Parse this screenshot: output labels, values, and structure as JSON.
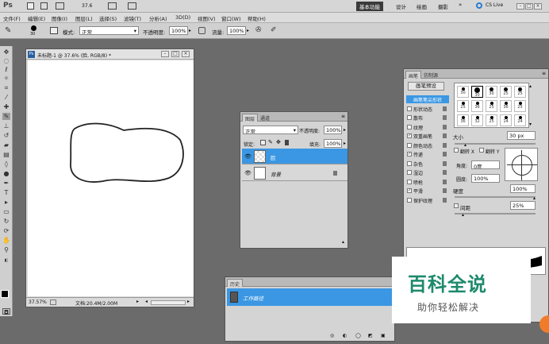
{
  "app": {
    "logo": "Ps",
    "workspace_label": "基本功能",
    "workspaces": [
      "设计",
      "绘画",
      "摄影"
    ],
    "more": "»",
    "cslive": "CS Live",
    "zoom": "37.6",
    "colors": {
      "blue": "#3b97e3",
      "live_icon": "#2a7bd1"
    }
  },
  "menu": [
    "文件(F)",
    "编辑(E)",
    "图像(I)",
    "图层(L)",
    "选择(S)",
    "滤镜(T)",
    "分析(A)",
    "3D(D)",
    "视图(V)",
    "窗口(W)",
    "帮助(H)"
  ],
  "options": {
    "brush_size": "30",
    "mode_label": "模式:",
    "mode_value": "正常",
    "opacity_label": "不透明度:",
    "opacity_value": "100%",
    "flow_label": "流量:",
    "flow_value": "100%"
  },
  "document": {
    "title": "未标题-1 @ 37.6% (脸, RGB/8) *",
    "zoom": "37.57%",
    "doc_info": "文档:20.4M/2.00M"
  },
  "layers": {
    "tabs": [
      "图层",
      "通道"
    ],
    "blend": "正常",
    "opacity_label": "不透明度:",
    "opacity": "100%",
    "lock_label": "锁定:",
    "fill_label": "填充:",
    "fill": "100%",
    "items": [
      {
        "name": "脸"
      },
      {
        "name": "背景"
      }
    ]
  },
  "history": {
    "tab": "历史",
    "items": [
      {
        "name": "工作路径"
      }
    ]
  },
  "brush_panel": {
    "tabs": [
      "画笔",
      "仿制源"
    ],
    "presets_button": "画笔预设",
    "categories": [
      {
        "label": "画笔笔尖形状",
        "checked": false
      },
      {
        "label": "形状动态",
        "checked": false
      },
      {
        "label": "散布",
        "checked": false
      },
      {
        "label": "纹理",
        "checked": false
      },
      {
        "label": "双重画笔",
        "checked": true
      },
      {
        "label": "颜色动态",
        "checked": false
      },
      {
        "label": "传递",
        "checked": true
      },
      {
        "label": "杂色",
        "checked": false
      },
      {
        "label": "湿边",
        "checked": false
      },
      {
        "label": "喷枪",
        "checked": false
      },
      {
        "label": "平滑",
        "checked": true
      },
      {
        "label": "保护纹理",
        "checked": false
      }
    ],
    "tip_sizes": [
      "30",
      "30",
      "30",
      "25",
      "25",
      "25",
      "36",
      "25",
      "36",
      "25",
      "36",
      "32",
      "25",
      "14",
      "24"
    ],
    "size_label": "大小",
    "size": "30 px",
    "flip_x": "翻转 X",
    "flip_y": "翻转 Y",
    "angle_label": "角度:",
    "angle": "0度",
    "roundness_label": "圆度:",
    "roundness": "100%",
    "hardness_label": "硬度",
    "hardness": "100%",
    "spacing_label": "间距",
    "spacing": "25%"
  },
  "watermark": {
    "title": "百科全说",
    "subtitle": "助你轻松解决"
  }
}
